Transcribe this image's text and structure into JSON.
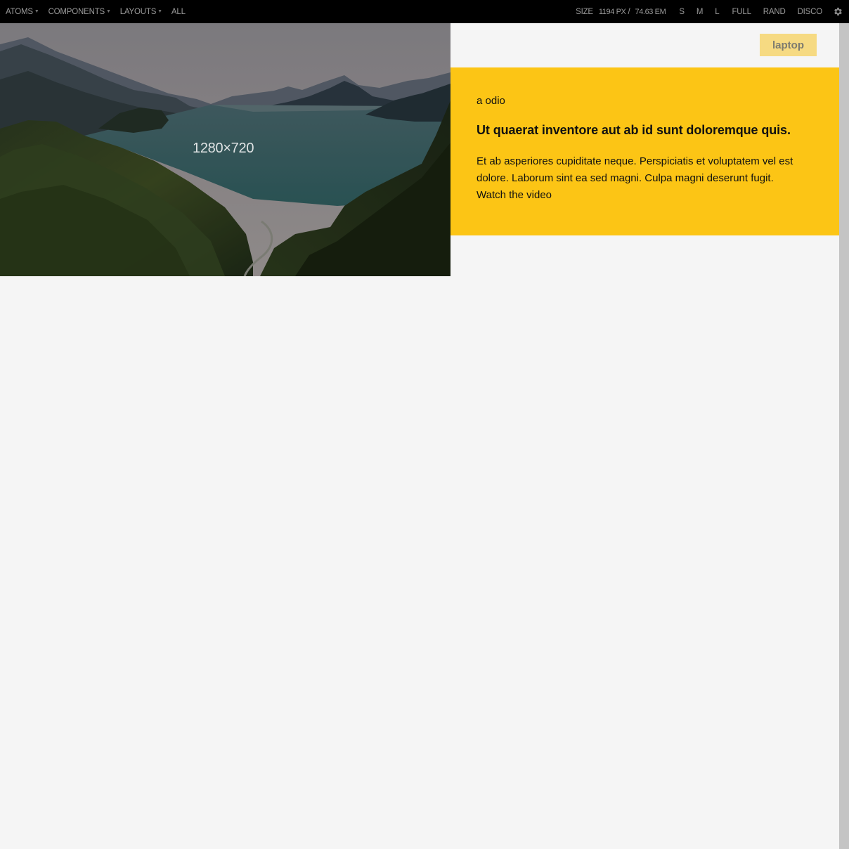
{
  "toolbar": {
    "nav": [
      {
        "label": "ATOMS",
        "dropdown": true
      },
      {
        "label": "COMPONENTS",
        "dropdown": true
      },
      {
        "label": "LAYOUTS",
        "dropdown": true
      },
      {
        "label": "ALL",
        "dropdown": false
      }
    ],
    "size_label": "SIZE",
    "size_px": "1194 PX",
    "size_sep": "/",
    "size_em": "74.63 EM",
    "buttons": [
      "S",
      "M",
      "L",
      "FULL",
      "RAND",
      "DISCO"
    ],
    "settings_icon": "gear-icon"
  },
  "hero": {
    "placeholder_text": "1280×720"
  },
  "badge": {
    "label": "laptop"
  },
  "card": {
    "eyebrow": "a odio",
    "headline": "Ut quaerat inventore aut ab id sunt doloremque quis.",
    "body": "Et ab asperiores cupiditate neque. Perspiciatis et voluptatem vel est dolore. Laborum sint ea sed magni. Culpa magni deserunt fugit.",
    "link": "Watch the video"
  },
  "colors": {
    "toolbar_bg": "#000000",
    "toolbar_text": "#9a9a9a",
    "panel_bg": "#fcc515",
    "badge_bg": "#f6da82",
    "page_bg": "#f5f5f5",
    "scrollbar": "#c4c4c4"
  }
}
